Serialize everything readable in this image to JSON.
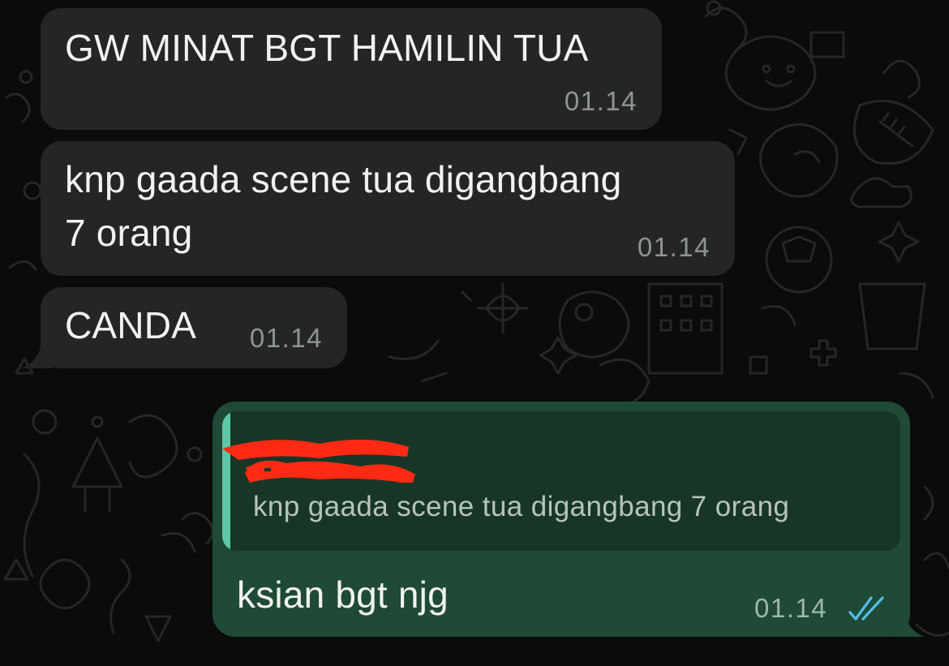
{
  "messages": [
    {
      "text": "GW MINAT BGT HAMILIN TUA",
      "time": "01.14",
      "direction": "incoming"
    },
    {
      "text_line1": "knp gaada scene tua digangbang",
      "text_line2": "7 orang",
      "time": "01.14",
      "direction": "incoming"
    },
    {
      "text": "CANDA",
      "time": "01.14",
      "direction": "incoming"
    }
  ],
  "reply": {
    "quoted_text": "knp gaada scene tua digangbang 7 orang",
    "text": "ksian bgt njg",
    "time": "01.14",
    "status": "read"
  },
  "colors": {
    "background": "#0b0b0b",
    "incoming_bubble": "#242626",
    "outgoing_bubble": "#1f4a35",
    "quote_bar": "#5dc8a5",
    "read_ticks": "#53bdeb",
    "redaction": "#ff2a14"
  }
}
